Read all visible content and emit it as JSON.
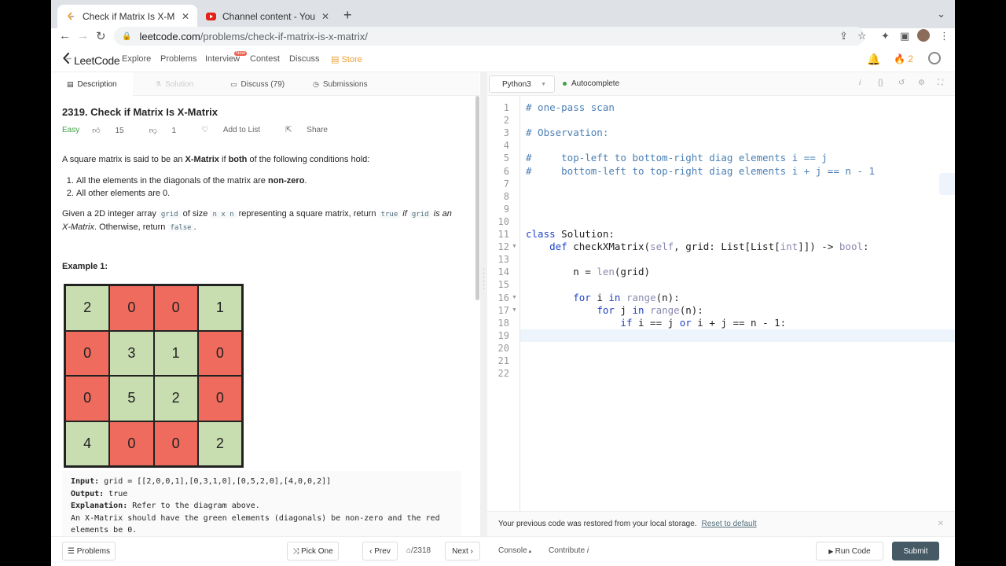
{
  "browser": {
    "tabs": [
      {
        "title": "Check if Matrix Is X-Matrix - Le",
        "active": true
      },
      {
        "title": "Channel content - YouTube Stu",
        "active": false
      }
    ],
    "url_host": "leetcode.com",
    "url_path": "/problems/check-if-matrix-is-x-matrix/"
  },
  "nav": {
    "logo": "LeetCode",
    "links": [
      "Explore",
      "Problems",
      "Interview",
      "Contest",
      "Discuss",
      "Store"
    ],
    "new_badge": "New",
    "streak": "2"
  },
  "left_tabs": [
    "Description",
    "Solution",
    "Discuss (79)",
    "Submissions"
  ],
  "problem": {
    "title": "2319. Check if Matrix Is X-Matrix",
    "difficulty": "Easy",
    "likes": "15",
    "dislikes": "1",
    "add_to_list": "Add to List",
    "share": "Share",
    "intro_a": "A square matrix is said to be an ",
    "intro_b": "X-Matrix",
    "intro_c": " if ",
    "intro_d": "both",
    "intro_e": " of the following conditions hold:",
    "cond1_a": "All the elements in the diagonals of the matrix are ",
    "cond1_b": "non-zero",
    "cond1_c": ".",
    "cond2": "All other elements are 0.",
    "p2_a": "Given a 2D integer array ",
    "p2_grid": "grid",
    "p2_b": " of size ",
    "p2_nxn": "n x n",
    "p2_c": " representing a square matrix, return ",
    "p2_true": "true",
    "p2_if": " if ",
    "p2_grid2": "grid",
    "p2_isan": " is an",
    "p2_xm": "X-Matrix",
    "p2_d": ". Otherwise, return ",
    "p2_false": "false",
    "p2_e": ".",
    "example_title": "Example 1:",
    "matrix": [
      [
        {
          "v": "2",
          "c": "g"
        },
        {
          "v": "0",
          "c": "r"
        },
        {
          "v": "0",
          "c": "r"
        },
        {
          "v": "1",
          "c": "g"
        }
      ],
      [
        {
          "v": "0",
          "c": "r"
        },
        {
          "v": "3",
          "c": "g"
        },
        {
          "v": "1",
          "c": "g"
        },
        {
          "v": "0",
          "c": "r"
        }
      ],
      [
        {
          "v": "0",
          "c": "r"
        },
        {
          "v": "5",
          "c": "g"
        },
        {
          "v": "2",
          "c": "g"
        },
        {
          "v": "0",
          "c": "r"
        }
      ],
      [
        {
          "v": "4",
          "c": "g"
        },
        {
          "v": "0",
          "c": "r"
        },
        {
          "v": "0",
          "c": "r"
        },
        {
          "v": "2",
          "c": "g"
        }
      ]
    ],
    "ex_input_label": "Input:",
    "ex_input": " grid = [[2,0,0,1],[0,3,1,0],[0,5,2,0],[4,0,0,2]]",
    "ex_output_label": "Output:",
    "ex_output": " true",
    "ex_expl_label": "Explanation:",
    "ex_expl": " Refer to the diagram above.",
    "ex_expl2": "An X-Matrix should have the green elements (diagonals) be non-zero and the red",
    "ex_expl3": "elements be 0."
  },
  "editor": {
    "language": "Python3",
    "autocomplete": "Autocomplete",
    "line_numbers": [
      "1",
      "2",
      "3",
      "4",
      "5",
      "6",
      "7",
      "8",
      "9",
      "10",
      "11",
      "12",
      "13",
      "14",
      "15",
      "16",
      "17",
      "18",
      "19",
      "20",
      "21",
      "22"
    ],
    "fold_lines": [
      12,
      16,
      17
    ],
    "lines": [
      [
        {
          "t": "# one-pass scan",
          "k": "cmt"
        }
      ],
      [],
      [
        {
          "t": "# Observation:",
          "k": "cmt"
        }
      ],
      [],
      [
        {
          "t": "#     top-left to bottom-right diag elements i == j",
          "k": "cmt"
        }
      ],
      [
        {
          "t": "#     bottom-left to top-right diag elements i + j == n - 1",
          "k": "cmt"
        }
      ],
      [],
      [],
      [],
      [],
      [
        {
          "t": "class",
          "k": "kw"
        },
        {
          "t": " Solution:",
          "k": ""
        }
      ],
      [
        {
          "t": "    ",
          "k": ""
        },
        {
          "t": "def",
          "k": "kw"
        },
        {
          "t": " checkXMatrix(",
          "k": ""
        },
        {
          "t": "self",
          "k": "bi"
        },
        {
          "t": ", grid: List[List[",
          "k": ""
        },
        {
          "t": "int",
          "k": "bi"
        },
        {
          "t": "]]) -> ",
          "k": ""
        },
        {
          "t": "bool",
          "k": "bi"
        },
        {
          "t": ":",
          "k": ""
        }
      ],
      [],
      [
        {
          "t": "        n = ",
          "k": ""
        },
        {
          "t": "len",
          "k": "bi"
        },
        {
          "t": "(grid)",
          "k": ""
        }
      ],
      [],
      [
        {
          "t": "        ",
          "k": ""
        },
        {
          "t": "for",
          "k": "kw"
        },
        {
          "t": " i ",
          "k": ""
        },
        {
          "t": "in",
          "k": "kw"
        },
        {
          "t": " ",
          "k": ""
        },
        {
          "t": "range",
          "k": "bi"
        },
        {
          "t": "(n):",
          "k": ""
        }
      ],
      [
        {
          "t": "            ",
          "k": ""
        },
        {
          "t": "for",
          "k": "kw"
        },
        {
          "t": " j ",
          "k": ""
        },
        {
          "t": "in",
          "k": "kw"
        },
        {
          "t": " ",
          "k": ""
        },
        {
          "t": "range",
          "k": "bi"
        },
        {
          "t": "(n):",
          "k": ""
        }
      ],
      [
        {
          "t": "                ",
          "k": ""
        },
        {
          "t": "if",
          "k": "kw"
        },
        {
          "t": " i == j ",
          "k": ""
        },
        {
          "t": "or",
          "k": "kw"
        },
        {
          "t": " i + j == n - 1:",
          "k": ""
        }
      ],
      [],
      [],
      [],
      []
    ]
  },
  "restore": {
    "message": "Your previous code was restored from your local storage.",
    "reset": "Reset to default"
  },
  "bottom": {
    "problems": "Problems",
    "pick_one": "Pick One",
    "prev": "Prev",
    "page": "/2318",
    "next": "Next",
    "console": "Console",
    "contribute": "Contribute",
    "run_code": "Run Code",
    "submit": "Submit"
  }
}
